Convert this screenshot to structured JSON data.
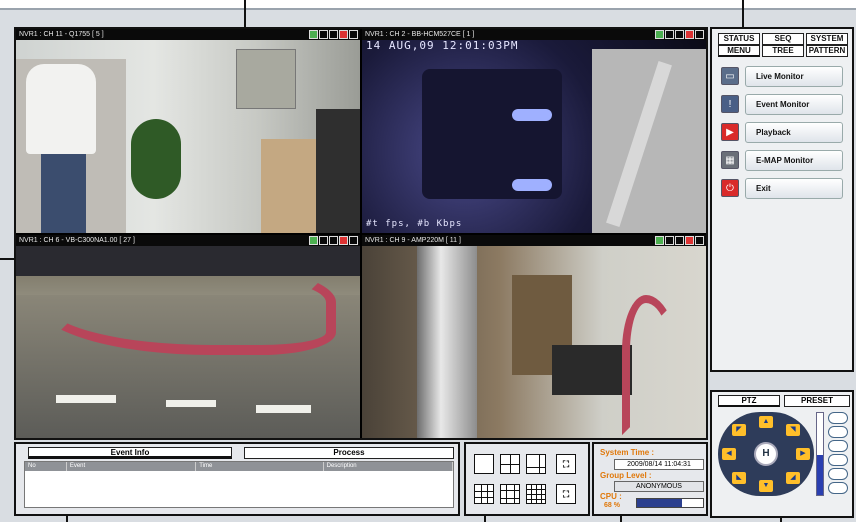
{
  "cameras": [
    {
      "title": "NVR1 : CH 11 - Q1755 [ 5 ]",
      "osd_top": "",
      "osd_bottom": ""
    },
    {
      "title": "NVR1 : CH 2 - BB-HCM527CE [ 1 ]",
      "osd_top": "14 AUG,09 12:01:03PM",
      "osd_bottom": "#t fps, #b Kbps"
    },
    {
      "title": "NVR1 : CH 6 - VB-C300NA1.00 [ 27 ]",
      "osd_top": "",
      "osd_bottom": ""
    },
    {
      "title": "NVR1 : CH 9 - AMP220M [ 11 ]",
      "osd_top": "",
      "osd_bottom": ""
    }
  ],
  "right_panel": {
    "tabs_row1": [
      "STATUS",
      "SEQ",
      "SYSTEM"
    ],
    "tabs_row2": [
      "MENU",
      "TREE",
      "PATTERN"
    ],
    "menu": [
      {
        "label": "Live Monitor",
        "icon": "monitor-icon",
        "color": "#5a6d8a"
      },
      {
        "label": "Event Monitor",
        "icon": "warning-icon",
        "color": "#4a5f86"
      },
      {
        "label": "Playback",
        "icon": "play-icon",
        "color": "#d92a2a"
      },
      {
        "label": "E-MAP Monitor",
        "icon": "map-icon",
        "color": "#6a6f78"
      },
      {
        "label": "Exit",
        "icon": "power-icon",
        "color": "#d92a2a"
      }
    ]
  },
  "ptz": {
    "tab_ptz": "PTZ",
    "tab_preset": "PRESET",
    "center_label": "H"
  },
  "event": {
    "tab_event": "Event Info",
    "tab_process": "Process",
    "columns": [
      "No",
      "Event",
      "Time",
      "Description"
    ]
  },
  "system": {
    "time_label": "System Time :",
    "time_value": "2009/08/14 11:04:31",
    "group_label": "Group Level :",
    "group_value": "ANONYMOUS",
    "cpu_label": "CPU :",
    "cpu_value": "68 %",
    "cpu_percent": 68
  },
  "layouts": [
    "1",
    "4",
    "6",
    "1-full",
    "9",
    "12",
    "16",
    "2-full"
  ]
}
